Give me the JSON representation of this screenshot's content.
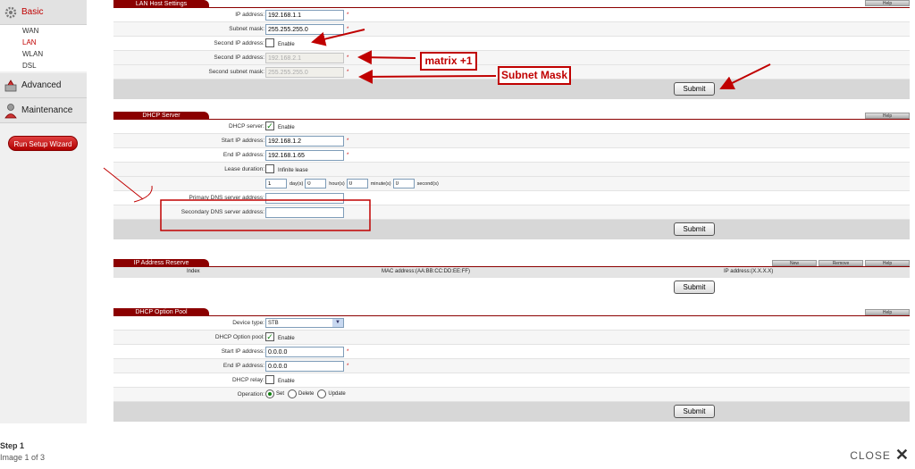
{
  "nav": {
    "basic": "Basic",
    "sub": [
      "WAN",
      "LAN",
      "WLAN",
      "DSL"
    ],
    "advanced": "Advanced",
    "maintenance": "Maintenance",
    "wizard": "Run Setup Wizard"
  },
  "lan": {
    "title": "LAN Host Settings",
    "help": "Help",
    "ip_label": "IP address:",
    "ip_value": "192.168.1.1",
    "mask_label": "Subnet mask:",
    "mask_value": "255.255.255.0",
    "second_label": "Second IP address:",
    "enable": "Enable",
    "second_ip_label": "Second IP address:",
    "second_ip_value": "192.168.2.1",
    "second_mask_label": "Second subnet mask:",
    "second_mask_value": "255.255.255.0",
    "submit": "Submit"
  },
  "annotations": {
    "matrix": "matrix +1",
    "subnet": "Subnet Mask",
    "colors": {
      "annotation": "#c00000"
    }
  },
  "dhcp": {
    "title": "DHCP Server",
    "help": "Help",
    "server_label": "DHCP server:",
    "enable": "Enable",
    "start_label": "Start IP address:",
    "start_value": "192.168.1.2",
    "end_label": "End IP address:",
    "end_value": "192.168.1.65",
    "lease_label": "Lease duration:",
    "infinite": "Infinite lease",
    "days": "1",
    "days_unit": "day(s)",
    "hours": "0",
    "hours_unit": "hour(s)",
    "minutes": "0",
    "minutes_unit": "minute(s)",
    "seconds": "0",
    "seconds_unit": "second(s)",
    "primary_dns_label": "Primary DNS server address:",
    "secondary_dns_label": "Secondary DNS server address:",
    "submit": "Submit"
  },
  "reserve": {
    "title": "IP Address Reserve",
    "new": "New",
    "remove": "Remove",
    "help": "Help",
    "col_index": "Index",
    "col_mac": "MAC address:(AA:BB:CC:DD:EE:FF)",
    "col_ip": "IP address:(X.X.X.X)",
    "submit": "Submit"
  },
  "pool": {
    "title": "DHCP Option Pool",
    "help": "Help",
    "device_label": "Device type:",
    "device_value": "STB",
    "pool_label": "DHCP Option pool:",
    "enable": "Enable",
    "start_label": "Start IP address:",
    "start_value": "0.0.0.0",
    "end_label": "End IP address:",
    "end_value": "0.0.0.0",
    "relay_label": "DHCP relay:",
    "relay_enable": "Enable",
    "op_label": "Operation:",
    "op_set": "Set",
    "op_delete": "Delete",
    "op_update": "Update",
    "submit": "Submit"
  },
  "footer": {
    "step": "Step 1",
    "image": "Image 1 of 3",
    "close": "CLOSE"
  }
}
